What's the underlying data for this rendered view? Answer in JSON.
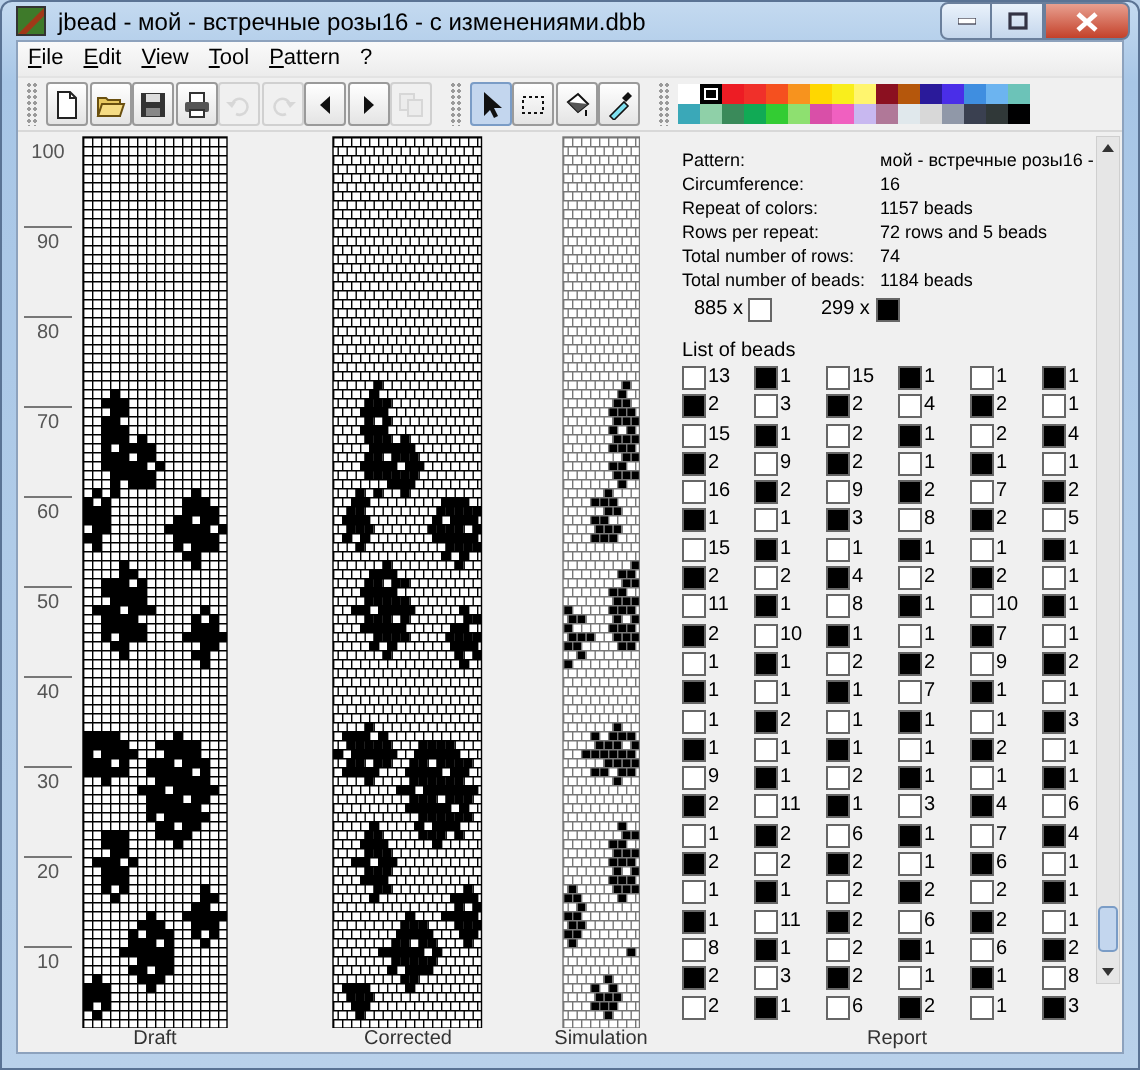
{
  "window": {
    "title": "jbead - мой - встречные розы16 - с изменениями.dbb"
  },
  "menu": [
    {
      "label": "File"
    },
    {
      "label": "Edit"
    },
    {
      "label": "View"
    },
    {
      "label": "Tool"
    },
    {
      "label": "Pattern"
    },
    {
      "label": "?"
    }
  ],
  "toolbar": [
    [
      {
        "kind": "new",
        "disabled": false,
        "selected": false
      },
      {
        "kind": "open",
        "disabled": false,
        "selected": false
      },
      {
        "kind": "save",
        "disabled": false,
        "selected": false
      },
      {
        "kind": "print",
        "disabled": false,
        "selected": false
      },
      {
        "kind": "undo",
        "disabled": true,
        "selected": false
      },
      {
        "kind": "redo",
        "disabled": true,
        "selected": false
      },
      {
        "kind": "left",
        "disabled": false,
        "selected": false
      },
      {
        "kind": "right",
        "disabled": false,
        "selected": false
      },
      {
        "kind": "copy",
        "disabled": true,
        "selected": false
      }
    ],
    [
      {
        "kind": "pointer",
        "disabled": false,
        "selected": true
      },
      {
        "kind": "select",
        "disabled": false,
        "selected": false
      },
      {
        "kind": "fill",
        "disabled": false,
        "selected": false
      },
      {
        "kind": "pipette",
        "disabled": false,
        "selected": false
      }
    ]
  ],
  "palette": [
    {
      "color": "#ffffff",
      "selected": false
    },
    {
      "color": "#000000",
      "selected": true
    },
    {
      "color": "#ed1c24",
      "selected": false
    },
    {
      "color": "#f0302a",
      "selected": false
    },
    {
      "color": "#f5501f",
      "selected": false
    },
    {
      "color": "#f7931e",
      "selected": false
    },
    {
      "color": "#ffd700",
      "selected": false
    },
    {
      "color": "#f9ee1c",
      "selected": false
    },
    {
      "color": "#fff56e",
      "selected": false
    },
    {
      "color": "#8b1020",
      "selected": false
    },
    {
      "color": "#b5570c",
      "selected": false
    },
    {
      "color": "#2a1a9a",
      "selected": false
    },
    {
      "color": "#4a2ee8",
      "selected": false
    },
    {
      "color": "#3f8ee0",
      "selected": false
    },
    {
      "color": "#6cb4f0",
      "selected": false
    },
    {
      "color": "#6cc3b8",
      "selected": false
    },
    {
      "color": "#3aa8b8",
      "selected": false
    },
    {
      "color": "#8fd0a8",
      "selected": false
    },
    {
      "color": "#3a8a5a",
      "selected": false
    },
    {
      "color": "#11aa55",
      "selected": false
    },
    {
      "color": "#33cc33",
      "selected": false
    },
    {
      "color": "#8ee070",
      "selected": false
    },
    {
      "color": "#d94fa8",
      "selected": false
    },
    {
      "color": "#f060c0",
      "selected": false
    },
    {
      "color": "#c8b8f0",
      "selected": false
    },
    {
      "color": "#b07898",
      "selected": false
    },
    {
      "color": "#e0e8ec",
      "selected": false
    },
    {
      "color": "#d8d8d8",
      "selected": false
    },
    {
      "color": "#9098a8",
      "selected": false
    },
    {
      "color": "#3a4050",
      "selected": false
    },
    {
      "color": "#303838",
      "selected": false
    },
    {
      "color": "#000001",
      "selected": false
    }
  ],
  "ruler": [
    "100",
    "90",
    "80",
    "70",
    "60",
    "50",
    "40",
    "30",
    "20",
    "10"
  ],
  "views": [
    {
      "label": "Draft",
      "kind": "draft"
    },
    {
      "label": "Corrected",
      "kind": "corrected"
    },
    {
      "label": "Simulation",
      "kind": "simulation"
    }
  ],
  "report": {
    "label": "Report",
    "fields": [
      {
        "label": "Pattern:",
        "value": "мой - встречные розы16 -"
      },
      {
        "label": "Circumference:",
        "value": "16"
      },
      {
        "label": "Repeat of colors:",
        "value": "1157 beads"
      },
      {
        "label": "Rows per repeat:",
        "value": "72 rows and 5 beads"
      },
      {
        "label": "Total number of rows:",
        "value": "74"
      },
      {
        "label": "Total number of beads:",
        "value": "1184 beads"
      }
    ],
    "color_counts": [
      {
        "count": "885 x",
        "color": "#ffffff"
      },
      {
        "count": "299 x",
        "color": "#000000"
      }
    ],
    "list_title": "List of beads",
    "columns": [
      [
        {
          "color": "#ffffff",
          "count": "13"
        },
        {
          "color": "#000000",
          "count": "2"
        },
        {
          "color": "#ffffff",
          "count": "15"
        },
        {
          "color": "#000000",
          "count": "2"
        },
        {
          "color": "#ffffff",
          "count": "16"
        },
        {
          "color": "#000000",
          "count": "1"
        },
        {
          "color": "#ffffff",
          "count": "15"
        },
        {
          "color": "#000000",
          "count": "2"
        },
        {
          "color": "#ffffff",
          "count": "11"
        },
        {
          "color": "#000000",
          "count": "2"
        },
        {
          "color": "#ffffff",
          "count": "1"
        },
        {
          "color": "#000000",
          "count": "1"
        },
        {
          "color": "#ffffff",
          "count": "1"
        },
        {
          "color": "#000000",
          "count": "1"
        },
        {
          "color": "#ffffff",
          "count": "9"
        },
        {
          "color": "#000000",
          "count": "2"
        },
        {
          "color": "#ffffff",
          "count": "1"
        },
        {
          "color": "#000000",
          "count": "2"
        },
        {
          "color": "#ffffff",
          "count": "1"
        },
        {
          "color": "#000000",
          "count": "1"
        },
        {
          "color": "#ffffff",
          "count": "8"
        },
        {
          "color": "#000000",
          "count": "2"
        },
        {
          "color": "#ffffff",
          "count": "2"
        }
      ],
      [
        {
          "color": "#000000",
          "count": "1"
        },
        {
          "color": "#ffffff",
          "count": "3"
        },
        {
          "color": "#000000",
          "count": "1"
        },
        {
          "color": "#ffffff",
          "count": "9"
        },
        {
          "color": "#000000",
          "count": "2"
        },
        {
          "color": "#ffffff",
          "count": "1"
        },
        {
          "color": "#000000",
          "count": "1"
        },
        {
          "color": "#ffffff",
          "count": "2"
        },
        {
          "color": "#000000",
          "count": "1"
        },
        {
          "color": "#ffffff",
          "count": "10"
        },
        {
          "color": "#000000",
          "count": "1"
        },
        {
          "color": "#ffffff",
          "count": "1"
        },
        {
          "color": "#000000",
          "count": "2"
        },
        {
          "color": "#ffffff",
          "count": "1"
        },
        {
          "color": "#000000",
          "count": "1"
        },
        {
          "color": "#ffffff",
          "count": "11"
        },
        {
          "color": "#000000",
          "count": "2"
        },
        {
          "color": "#ffffff",
          "count": "2"
        },
        {
          "color": "#000000",
          "count": "1"
        },
        {
          "color": "#ffffff",
          "count": "11"
        },
        {
          "color": "#000000",
          "count": "1"
        },
        {
          "color": "#ffffff",
          "count": "3"
        },
        {
          "color": "#000000",
          "count": "1"
        }
      ],
      [
        {
          "color": "#ffffff",
          "count": "15"
        },
        {
          "color": "#000000",
          "count": "2"
        },
        {
          "color": "#ffffff",
          "count": "2"
        },
        {
          "color": "#000000",
          "count": "2"
        },
        {
          "color": "#ffffff",
          "count": "9"
        },
        {
          "color": "#000000",
          "count": "3"
        },
        {
          "color": "#ffffff",
          "count": "1"
        },
        {
          "color": "#000000",
          "count": "4"
        },
        {
          "color": "#ffffff",
          "count": "8"
        },
        {
          "color": "#000000",
          "count": "1"
        },
        {
          "color": "#ffffff",
          "count": "2"
        },
        {
          "color": "#000000",
          "count": "1"
        },
        {
          "color": "#ffffff",
          "count": "1"
        },
        {
          "color": "#000000",
          "count": "1"
        },
        {
          "color": "#ffffff",
          "count": "2"
        },
        {
          "color": "#000000",
          "count": "1"
        },
        {
          "color": "#ffffff",
          "count": "6"
        },
        {
          "color": "#000000",
          "count": "2"
        },
        {
          "color": "#ffffff",
          "count": "2"
        },
        {
          "color": "#000000",
          "count": "2"
        },
        {
          "color": "#ffffff",
          "count": "2"
        },
        {
          "color": "#000000",
          "count": "2"
        },
        {
          "color": "#ffffff",
          "count": "6"
        }
      ],
      [
        {
          "color": "#000000",
          "count": "1"
        },
        {
          "color": "#ffffff",
          "count": "4"
        },
        {
          "color": "#000000",
          "count": "1"
        },
        {
          "color": "#ffffff",
          "count": "1"
        },
        {
          "color": "#000000",
          "count": "2"
        },
        {
          "color": "#ffffff",
          "count": "8"
        },
        {
          "color": "#000000",
          "count": "1"
        },
        {
          "color": "#ffffff",
          "count": "2"
        },
        {
          "color": "#000000",
          "count": "1"
        },
        {
          "color": "#ffffff",
          "count": "1"
        },
        {
          "color": "#000000",
          "count": "2"
        },
        {
          "color": "#ffffff",
          "count": "7"
        },
        {
          "color": "#000000",
          "count": "1"
        },
        {
          "color": "#ffffff",
          "count": "1"
        },
        {
          "color": "#000000",
          "count": "1"
        },
        {
          "color": "#ffffff",
          "count": "3"
        },
        {
          "color": "#000000",
          "count": "1"
        },
        {
          "color": "#ffffff",
          "count": "1"
        },
        {
          "color": "#000000",
          "count": "2"
        },
        {
          "color": "#ffffff",
          "count": "6"
        },
        {
          "color": "#000000",
          "count": "1"
        },
        {
          "color": "#ffffff",
          "count": "1"
        },
        {
          "color": "#000000",
          "count": "2"
        }
      ],
      [
        {
          "color": "#ffffff",
          "count": "1"
        },
        {
          "color": "#000000",
          "count": "2"
        },
        {
          "color": "#ffffff",
          "count": "2"
        },
        {
          "color": "#000000",
          "count": "1"
        },
        {
          "color": "#ffffff",
          "count": "7"
        },
        {
          "color": "#000000",
          "count": "2"
        },
        {
          "color": "#ffffff",
          "count": "1"
        },
        {
          "color": "#000000",
          "count": "2"
        },
        {
          "color": "#ffffff",
          "count": "10"
        },
        {
          "color": "#000000",
          "count": "7"
        },
        {
          "color": "#ffffff",
          "count": "9"
        },
        {
          "color": "#000000",
          "count": "1"
        },
        {
          "color": "#ffffff",
          "count": "1"
        },
        {
          "color": "#000000",
          "count": "2"
        },
        {
          "color": "#ffffff",
          "count": "1"
        },
        {
          "color": "#000000",
          "count": "4"
        },
        {
          "color": "#ffffff",
          "count": "7"
        },
        {
          "color": "#000000",
          "count": "6"
        },
        {
          "color": "#ffffff",
          "count": "2"
        },
        {
          "color": "#000000",
          "count": "2"
        },
        {
          "color": "#ffffff",
          "count": "6"
        },
        {
          "color": "#000000",
          "count": "1"
        },
        {
          "color": "#ffffff",
          "count": "1"
        }
      ],
      [
        {
          "color": "#000000",
          "count": "1"
        },
        {
          "color": "#ffffff",
          "count": "1"
        },
        {
          "color": "#000000",
          "count": "4"
        },
        {
          "color": "#ffffff",
          "count": "1"
        },
        {
          "color": "#000000",
          "count": "2"
        },
        {
          "color": "#ffffff",
          "count": "5"
        },
        {
          "color": "#000000",
          "count": "1"
        },
        {
          "color": "#ffffff",
          "count": "1"
        },
        {
          "color": "#000000",
          "count": "1"
        },
        {
          "color": "#ffffff",
          "count": "1"
        },
        {
          "color": "#000000",
          "count": "2"
        },
        {
          "color": "#ffffff",
          "count": "1"
        },
        {
          "color": "#000000",
          "count": "3"
        },
        {
          "color": "#ffffff",
          "count": "1"
        },
        {
          "color": "#000000",
          "count": "1"
        },
        {
          "color": "#ffffff",
          "count": "6"
        },
        {
          "color": "#000000",
          "count": "4"
        },
        {
          "color": "#ffffff",
          "count": "1"
        },
        {
          "color": "#000000",
          "count": "1"
        },
        {
          "color": "#ffffff",
          "count": "1"
        },
        {
          "color": "#000000",
          "count": "2"
        },
        {
          "color": "#ffffff",
          "count": "8"
        },
        {
          "color": "#000000",
          "count": "3"
        }
      ]
    ]
  }
}
